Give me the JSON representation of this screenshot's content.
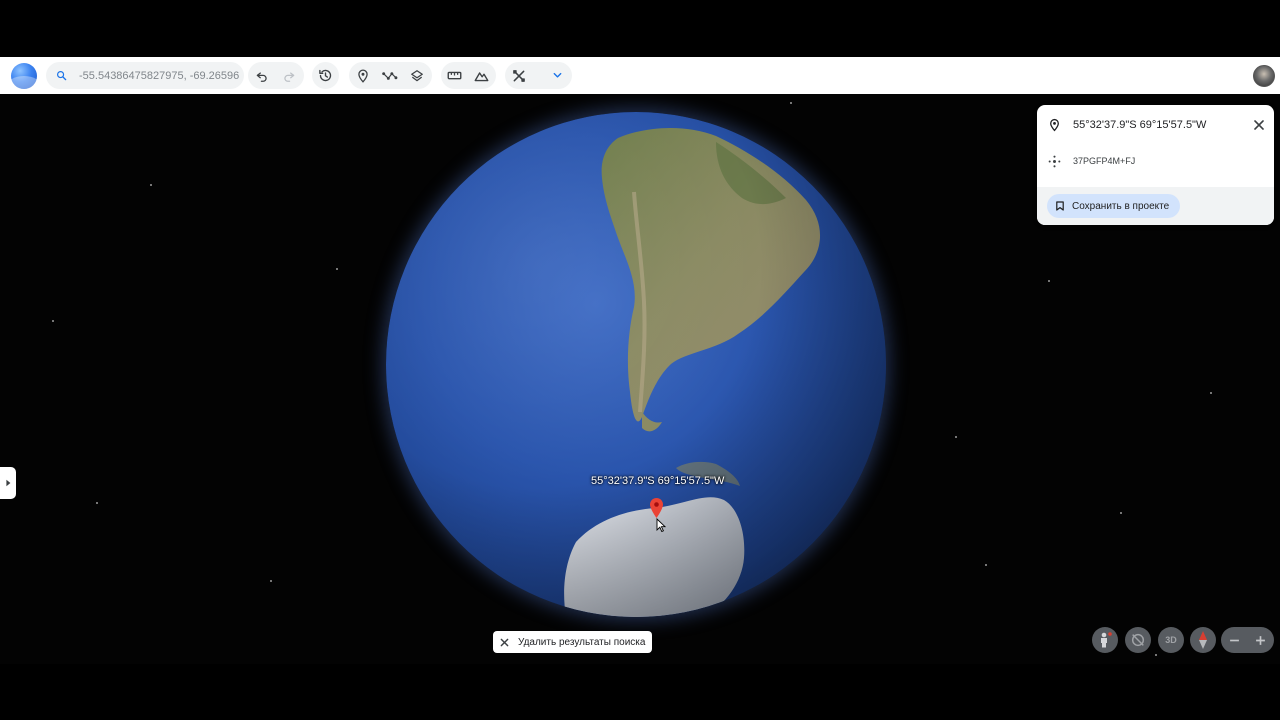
{
  "toolbar": {
    "search_value": "-55.54386475827975, -69.26596",
    "icons": [
      "undo-icon",
      "redo-icon",
      "history-icon",
      "placemark-icon",
      "path-icon",
      "layers-icon",
      "ruler-icon",
      "elevation-icon",
      "tools-icon",
      "chevron-down-icon"
    ]
  },
  "globe": {
    "label": "55°32'37.9\"S 69°15'57.5\"W"
  },
  "info_panel": {
    "coordinates": "55°32'37.9\"S 69°15'57.5\"W",
    "plus_code": "37PGFP4M+FJ",
    "save_label": "Сохранить в проекте"
  },
  "clear_results": {
    "label": "Удалить результаты поиска"
  },
  "controls": {
    "three_d_label": "3D"
  },
  "colors": {
    "toolbar_bg": "#ffffff",
    "space_bg": "#030303",
    "ocean": "#2a55ad",
    "pin": "#ea4335",
    "save_chip": "#d2e3fc",
    "control_bg": "#5f6368"
  }
}
